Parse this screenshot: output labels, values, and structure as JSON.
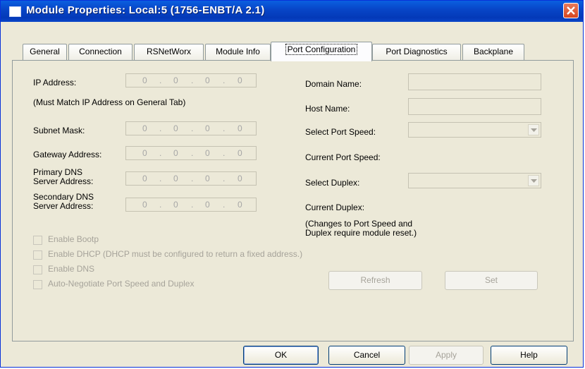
{
  "window": {
    "title": "Module Properties: Local:5 (1756-ENBT/A 2.1)"
  },
  "tabs": [
    {
      "label": "General"
    },
    {
      "label": "Connection"
    },
    {
      "label": "RSNetWorx"
    },
    {
      "label": "Module Info"
    },
    {
      "label": "Port Configuration",
      "active": true
    },
    {
      "label": "Port Diagnostics"
    },
    {
      "label": "Backplane"
    }
  ],
  "left": {
    "ip_label": "IP Address:",
    "ip_note": "(Must Match IP Address on General Tab)",
    "subnet_label": "Subnet Mask:",
    "gateway_label": "Gateway Address:",
    "primary_dns_line1": "Primary DNS",
    "primary_dns_line2": "Server Address:",
    "secondary_dns_line1": "Secondary DNS",
    "secondary_dns_line2": "Server Address:",
    "ip_octets": [
      "0",
      "0",
      "0",
      "0"
    ],
    "subnet_octets": [
      "0",
      "0",
      "0",
      "0"
    ],
    "gateway_octets": [
      "0",
      "0",
      "0",
      "0"
    ],
    "primary_dns_octets": [
      "0",
      "0",
      "0",
      "0"
    ],
    "secondary_dns_octets": [
      "0",
      "0",
      "0",
      "0"
    ],
    "dot": "."
  },
  "right": {
    "domain_label": "Domain Name:",
    "host_label": "Host Name:",
    "select_speed_label": "Select Port Speed:",
    "current_speed_label": "Current Port Speed:",
    "select_duplex_label": "Select Duplex:",
    "current_duplex_label": "Current Duplex:",
    "reset_note_line1": "(Changes to Port Speed and",
    "reset_note_line2": "Duplex require module reset.)"
  },
  "checkboxes": {
    "bootp": "Enable Bootp",
    "dhcp": "Enable DHCP  (DHCP must be configured to return a fixed address.)",
    "dns": "Enable DNS",
    "autoneg": "Auto-Negotiate Port Speed and Duplex"
  },
  "buttons": {
    "refresh": "Refresh",
    "set": "Set",
    "ok": "OK",
    "cancel": "Cancel",
    "apply": "Apply",
    "help": "Help"
  }
}
